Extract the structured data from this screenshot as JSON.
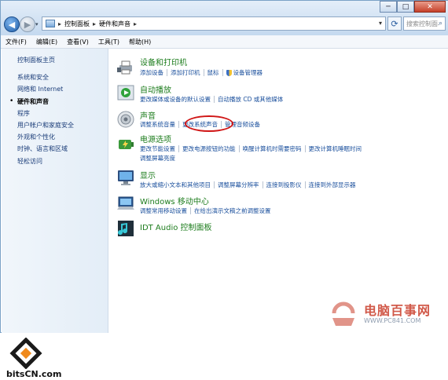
{
  "window": {
    "address": {
      "crumbs": [
        "控制面板",
        "硬件和声音"
      ]
    },
    "search_placeholder": "搜索控制面板",
    "controls": {
      "minimize": "─",
      "maximize": "□",
      "close": "✕"
    }
  },
  "menu": [
    "文件(F)",
    "编辑(E)",
    "查看(V)",
    "工具(T)",
    "帮助(H)"
  ],
  "sidebar": {
    "home": "控制面板主页",
    "items": [
      "系统和安全",
      "网络和 Internet",
      "硬件和声音",
      "程序",
      "用户帐户和家庭安全",
      "外观和个性化",
      "时钟、语言和区域",
      "轻松访问"
    ],
    "active_index": 2
  },
  "categories": [
    {
      "title": "设备和打印机",
      "icon": "printer-icon",
      "links": [
        [
          "添加设备",
          "添加打印机",
          "鼠标",
          "设备管理器"
        ]
      ]
    },
    {
      "title": "自动播放",
      "icon": "autoplay-icon",
      "links": [
        [
          "更改媒体或设备的默认设置",
          "自动播放 CD 或其他媒体"
        ]
      ]
    },
    {
      "title": "声音",
      "icon": "speaker-icon",
      "links": [
        [
          "调整系统音量",
          "更改系统声音",
          "管理音频设备"
        ]
      ]
    },
    {
      "title": "电源选项",
      "icon": "power-icon",
      "links": [
        [
          "更改节能设置",
          "更改电源按钮的功能",
          "唤醒计算机时需要密码",
          "更改计算机睡眠时间"
        ],
        [
          "调整屏幕亮度"
        ]
      ]
    },
    {
      "title": "显示",
      "icon": "display-icon",
      "links": [
        [
          "放大或缩小文本和其他项目",
          "调整屏幕分辨率",
          "连接到投影仪",
          "连接到外部显示器"
        ]
      ]
    },
    {
      "title": "Windows 移动中心",
      "icon": "mobility-center-icon",
      "links": [
        [
          "调整常用移动设置",
          "在给出演示文稿之前调整设置"
        ]
      ]
    },
    {
      "title": "IDT Audio 控制面板",
      "icon": "idt-audio-icon",
      "links": []
    }
  ],
  "watermarks": {
    "left": "bitsCN.com",
    "right_name": "电脑百事网",
    "right_url": "WWW.PC841.COM"
  },
  "colors": {
    "accent_green": "#1e7d1e",
    "link_blue": "#1a4f9c",
    "highlight_red": "#d01515"
  }
}
